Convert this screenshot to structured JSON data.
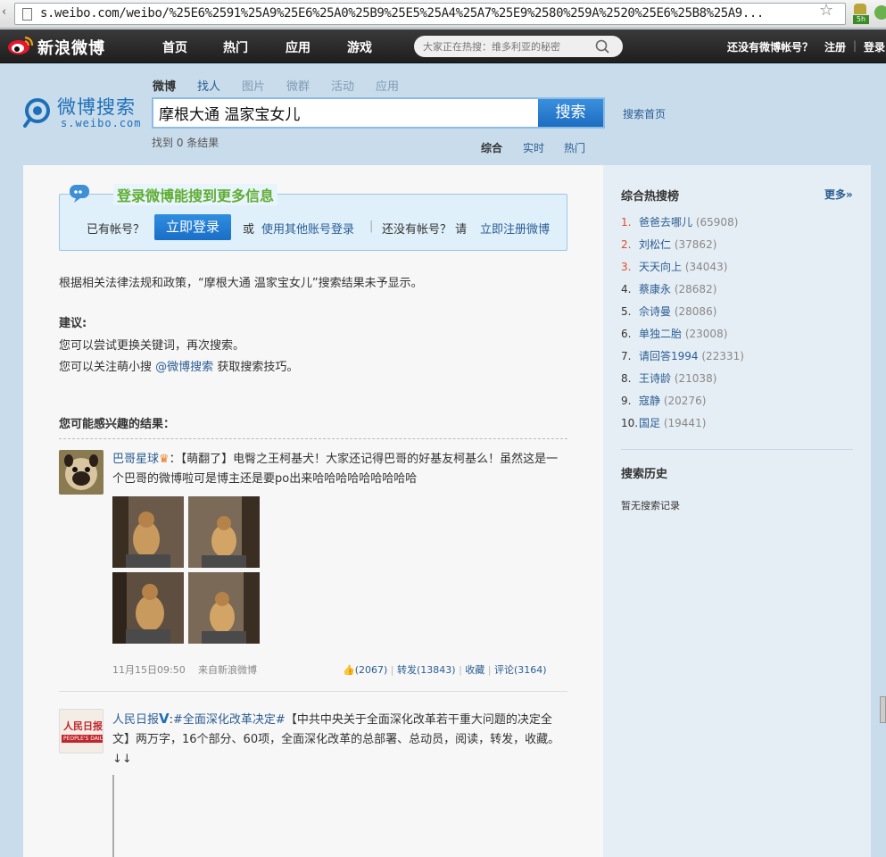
{
  "browser": {
    "url": "s.weibo.com/weibo/%25E6%2591%25A9%25E6%25A0%25B9%25E5%25A4%25A7%25E9%2580%259A%2520%25E6%25B8%25A9...",
    "ext_badge": "5h"
  },
  "topnav": {
    "logo": "新浪微博",
    "items": [
      "首页",
      "热门",
      "应用",
      "游戏"
    ],
    "search_placeholder": "大家正在热搜：维多利亚的秘密",
    "no_account": "还没有微博帐号？",
    "register": "注册",
    "sep": "|",
    "login": "登录"
  },
  "brand": {
    "title": "微博搜索",
    "sub": "s.weibo.com"
  },
  "search_tabs": [
    "微博",
    "找人",
    "图片",
    "微群",
    "活动",
    "应用"
  ],
  "query": "摩根大通 温家宝女儿",
  "search_button": "搜索",
  "search_home": "搜索首页",
  "result_count": "找到 0 条结果",
  "result_tabs": [
    "综合",
    "实时",
    "热门"
  ],
  "login_box": {
    "headline": "登录微博能搜到更多信息",
    "have_account": "已有帐号？",
    "login_button": "立即登录",
    "or": "或",
    "other_login": "使用其他账号登录",
    "sep": "|",
    "no_account": "还没有帐号？ 请",
    "register": "立即注册微博"
  },
  "notice": "根据相关法律法规和政策，“摩根大通 温家宝女儿”搜索结果未予显示。",
  "suggestions": {
    "title": "建议:",
    "line1": "您可以尝试更换关键词，再次搜索。",
    "line2_pre": "您可以关注萌小搜",
    "line2_link": "@微博搜索",
    "line2_post": "获取搜索技巧。"
  },
  "interest_title": "您可能感兴趣的结果：",
  "posts": [
    {
      "user": "巴哥星球",
      "text": "：【萌翻了】电臀之王柯基犬！大家还记得巴哥的好基友柯基么！虽然这是一个巴哥的微博啦可是博主还是要po出来哈哈哈哈哈哈哈哈哈",
      "time": "11月15日09:50",
      "source": "来自新浪微博",
      "likes": "(2067)",
      "repost": "转发(13843)",
      "fav": "收藏",
      "comment": "评论(3164)",
      "sep": "|"
    },
    {
      "user": "人民日报",
      "topic": "#全面深化改革决定#",
      "text": "【中共中央关于全面深化改革若干重大问题的决定全文】两万字，16个部分、60项，全面深化改革的总部署、总动员，阅读，转发，收藏。↓↓",
      "avatar_text": "人民日报",
      "avatar_sub": "PEOPLE'S DAILY"
    }
  ],
  "sidebar": {
    "hot_title": "综合热搜榜",
    "more": "更多»",
    "hot": [
      {
        "rank": "1.",
        "term": "爸爸去哪儿",
        "count": "(65908)"
      },
      {
        "rank": "2.",
        "term": "刘松仁",
        "count": "(37862)"
      },
      {
        "rank": "3.",
        "term": "天天向上",
        "count": "(34043)"
      },
      {
        "rank": "4.",
        "term": "蔡康永",
        "count": "(28682)"
      },
      {
        "rank": "5.",
        "term": "佘诗曼",
        "count": "(28086)"
      },
      {
        "rank": "6.",
        "term": "单独二胎",
        "count": "(23008)"
      },
      {
        "rank": "7.",
        "term": "请回答1994",
        "count": "(22331)"
      },
      {
        "rank": "8.",
        "term": "王诗龄",
        "count": "(21038)"
      },
      {
        "rank": "9.",
        "term": "寇静",
        "count": "(20276)"
      },
      {
        "rank": "10.",
        "term": "国足",
        "count": "(19441)"
      }
    ],
    "history_title": "搜索历史",
    "no_history": "暂无搜索记录"
  },
  "colors": {
    "link": "#2a5d92",
    "accent": "#1e6fb7",
    "hot_rank": "#e04b2c",
    "login_green": "#5fae35"
  }
}
